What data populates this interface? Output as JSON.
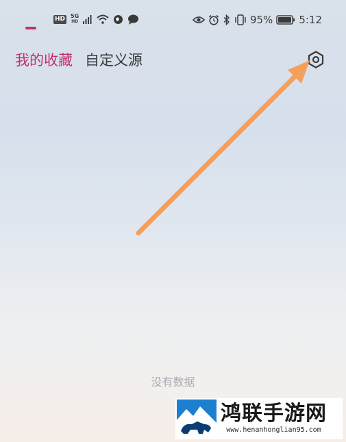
{
  "status_bar": {
    "left_badge": "HD",
    "network": "5G",
    "network_sub": "HD",
    "battery_percent": "95%",
    "time": "5:12",
    "icons": [
      "hd-icon",
      "signal-icon",
      "wifi-icon",
      "vpn-icon",
      "message-icon",
      "eye-icon",
      "alarm-icon",
      "bluetooth-icon",
      "vibrate-icon",
      "battery-icon"
    ]
  },
  "tabs": [
    {
      "label": "我的收藏",
      "active": true
    },
    {
      "label": "自定义源",
      "active": false
    }
  ],
  "settings": {
    "icon": "gear-icon"
  },
  "annotation": {
    "color": "#f4a05c"
  },
  "empty_state": {
    "text": "没有数据"
  },
  "watermark": {
    "title": "鸿联手游网",
    "url": "www.henanhonglian95.com"
  },
  "colors": {
    "accent": "#c4306e",
    "muted_text": "#a8acb2"
  }
}
